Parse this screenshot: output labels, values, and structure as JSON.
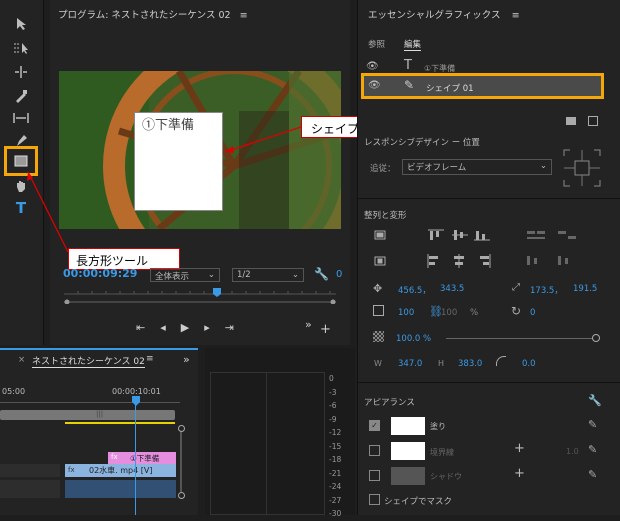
{
  "program": {
    "title": "プログラム: ネストされたシーケンス 02",
    "menu": "≡",
    "timecode": "00:00:09:29",
    "zoom": "全体表示",
    "resolution": "1/2"
  },
  "video": {
    "shape_text": "①下準備"
  },
  "callouts": {
    "shape": "シェイプ",
    "rectangle_tool": "長方形ツール"
  },
  "essential": {
    "title": "エッセンシャルグラフィックス",
    "menu": "≡",
    "tabs": [
      "参照",
      "編集"
    ],
    "layers": [
      {
        "name": "①下準備"
      },
      {
        "name": "シェイプ 01"
      }
    ],
    "responsive": {
      "label": "レスポンシブデザイン ー 位置",
      "follow_label": "追従：",
      "follow_value": "ビデオフレーム"
    },
    "align_title": "整列と変形",
    "transform": {
      "pos_x": "456.5，",
      "pos_y": "343.5",
      "anchor_x": "173.5，",
      "anchor_y": "191.5",
      "scale": "100",
      "scale2": "100",
      "percent": "%",
      "rotation": "0",
      "opacity": "100.0 %",
      "w_label": "W",
      "w": "347.0",
      "h_label": "H",
      "h": "383.0",
      "radius": "0.0"
    },
    "appearance_title": "アピアランス",
    "fill_label": "塗り",
    "stroke_label": "境界線",
    "stroke_width": "1.0",
    "shadow_label": "シャドウ",
    "mask_label": "シェイプでマスク"
  },
  "timeline": {
    "title": "ネストされたシーケンス 02",
    "menu": "≡",
    "close": "×",
    "time_left": "05:00",
    "time_right": "00:00:10:01",
    "clip1": "①下準備",
    "clip2": "02水車. mp4 [V]",
    "more": "»"
  },
  "meter": {
    "scale": [
      "0",
      "-3",
      "-6",
      "-9",
      "-12",
      "-15",
      "-18",
      "-21",
      "-24",
      "-27",
      "-30"
    ]
  }
}
